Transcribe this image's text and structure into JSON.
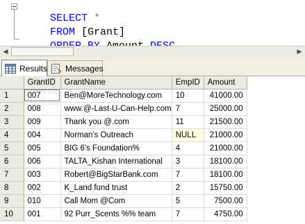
{
  "editor": {
    "lines": [
      {
        "kw": "SELECT",
        "rest": " *",
        "rest_class": "sym"
      },
      {
        "kw": "FROM",
        "rest": " [Grant]",
        "rest_class": "ident"
      },
      {
        "kw": "ORDER BY",
        "rest": " Amount ",
        "kw2": "DESC"
      }
    ]
  },
  "tabs": {
    "results_label": "Results",
    "messages_label": "Messages"
  },
  "grid": {
    "columns": [
      "",
      "GrantID",
      "GrantName",
      "EmpID",
      "Amount"
    ],
    "rows": [
      {
        "n": "1",
        "GrantID": "007",
        "GrantName": "Ben@MoreTechnology.com",
        "EmpID": "10",
        "Amount": "41000.00"
      },
      {
        "n": "2",
        "GrantID": "008",
        "GrantName": "www.@-Last-U-Can-Help.com",
        "EmpID": "7",
        "Amount": "25000.00"
      },
      {
        "n": "3",
        "GrantID": "009",
        "GrantName": "Thank you @.com",
        "EmpID": "11",
        "Amount": "21500.00"
      },
      {
        "n": "4",
        "GrantID": "004",
        "GrantName": "Norman's Outreach",
        "EmpID": "NULL",
        "Amount": "21000.00"
      },
      {
        "n": "5",
        "GrantID": "005",
        "GrantName": "BIG 6's Foundation%",
        "EmpID": "4",
        "Amount": "21000.00"
      },
      {
        "n": "6",
        "GrantID": "006",
        "GrantName": "TALTA_Kishan International",
        "EmpID": "3",
        "Amount": "18100.00"
      },
      {
        "n": "7",
        "GrantID": "003",
        "GrantName": "Robert@BigStarBank.com",
        "EmpID": "7",
        "Amount": "18100.00"
      },
      {
        "n": "8",
        "GrantID": "002",
        "GrantName": "K_Land fund trust",
        "EmpID": "2",
        "Amount": "15750.00"
      },
      {
        "n": "9",
        "GrantID": "010",
        "GrantName": "Call Mom @Com",
        "EmpID": "5",
        "Amount": "7500.00"
      },
      {
        "n": "10",
        "GrantID": "001",
        "GrantName": "92 Purr_Scents %% team",
        "EmpID": "7",
        "Amount": "4750.00"
      }
    ]
  },
  "colors": {
    "keyword": "#0000ff",
    "null_bg": "#ffffe1"
  },
  "icons": {
    "results_tab": "grid-icon",
    "messages_tab": "messages-icon"
  }
}
